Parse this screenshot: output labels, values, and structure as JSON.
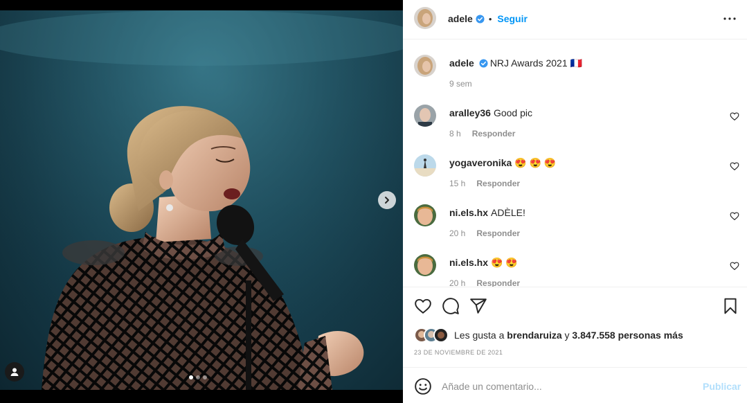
{
  "post": {
    "author": "adele",
    "follow_label": "Seguir",
    "separator": "•",
    "caption": "NRJ Awards 2021 🇫🇷",
    "caption_time": "9 sem",
    "carousel": {
      "slides": 3,
      "active": 1
    }
  },
  "comments": [
    {
      "user": "aralley36",
      "text": "Good pic",
      "time": "8 h",
      "reply": "Responder"
    },
    {
      "user": "yogaveronika",
      "text": "😍 😍 😍",
      "time": "15 h",
      "reply": "Responder"
    },
    {
      "user": "ni.els.hx",
      "text": "ADÈLE!",
      "time": "20 h",
      "reply": "Responder"
    },
    {
      "user": "ni.els.hx",
      "text": "😍 😍",
      "time": "20 h",
      "reply": "Responder"
    }
  ],
  "likes": {
    "prefix": "Les gusta a",
    "user": "brendaruiza",
    "conj": "y",
    "count_text": "3.847.558 personas más"
  },
  "date": "23 DE NOVIEMBRE DE 2021",
  "composer": {
    "placeholder": "Añade un comentario...",
    "post_label": "Publicar"
  },
  "icons": {
    "verified": "verified-badge-icon",
    "more": "more-options-icon",
    "like": "heart-icon",
    "comment": "comment-icon",
    "share": "share-icon",
    "save": "bookmark-icon",
    "emoji": "emoji-icon",
    "next": "chevron-right-icon",
    "tag": "user-tag-icon"
  },
  "colors": {
    "accent": "#0095f6",
    "muted": "#8e8e8e",
    "text": "#262626",
    "post_disabled": "#b2dffc"
  }
}
